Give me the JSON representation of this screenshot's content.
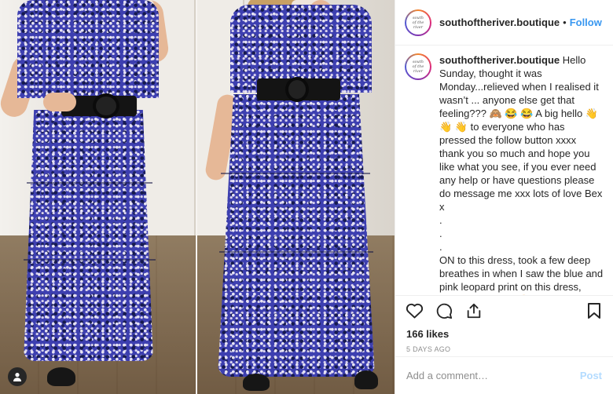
{
  "header": {
    "username": "southoftheriver.boutique",
    "separator": "•",
    "follow_label": "Follow"
  },
  "caption": {
    "username": "southoftheriver.boutique",
    "text": "Hello Sunday, thought it was Monday...relieved when I realised it wasn’t ... anyone else get that feeling??? 🙈 😂 😂 A big hello 👋 👋 👋 to everyone who has pressed the follow button xxxx thank you so much and hope you like what you see, if you ever need any help or have questions please do message me xxx lots of love Bex x\n.\n.\n.\nON to this dress, took a few deep breathes in when I saw the blue and pink leopard print on this dress, absolutely love it 😍 , the tiered skirt part brings something extra to a dress - and is lined to the last tier, the belt comes with the dress, up to you if you"
  },
  "actions": {
    "icons": [
      "heart-icon",
      "comment-icon",
      "share-icon",
      "bookmark-icon"
    ]
  },
  "likes": "166 likes",
  "timestamp": "5 DAYS AGO",
  "comment": {
    "placeholder": "Add a comment…",
    "post_label": "Post"
  },
  "colors": {
    "link_blue": "#3897f0",
    "post_disabled": "#b3dbff",
    "muted": "#8e8e8e",
    "dress_blue": "#3d3fb0"
  }
}
